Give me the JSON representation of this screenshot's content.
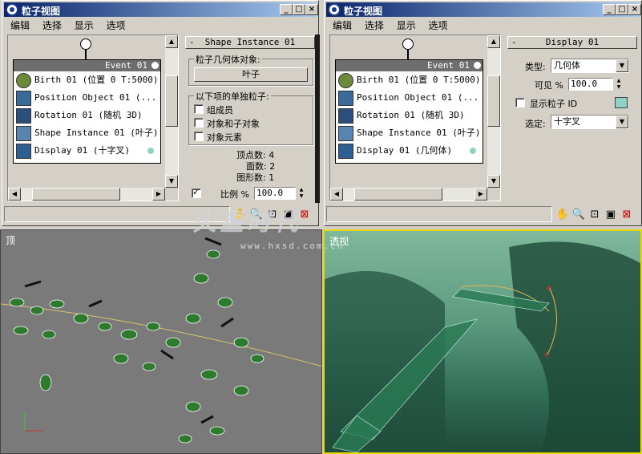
{
  "left_window": {
    "title": "粒子视图",
    "title_buttons": [
      "_",
      "□",
      "×"
    ],
    "menu": [
      "编辑",
      "选择",
      "显示",
      "选项"
    ],
    "event_header": "Event 01",
    "operators": [
      {
        "label": "Birth 01 (位置 0 T:5000)",
        "icon": "birth-icon"
      },
      {
        "label": "Position Object 01 (...",
        "icon": "position-icon"
      },
      {
        "label": "Rotation 01 (随机 3D)",
        "icon": "rotation-icon"
      },
      {
        "label": "Shape Instance 01 (叶子)",
        "icon": "shape-instance-icon"
      },
      {
        "label": "Display 01 (十字叉)",
        "icon": "display-icon"
      }
    ],
    "rollout": {
      "title": "Shape Instance 01",
      "geom_group": "粒子几何体对象:",
      "geom_button": "叶子",
      "separate_group": "以下项的单独粒子:",
      "checkboxes": [
        "组成员",
        "对象和子对象",
        "对象元素"
      ],
      "vertex_count": "顶点数: 4",
      "face_count": "面数: 2",
      "element_count": "图形数: 1",
      "scale_label": "比例 %",
      "scale_value": "100.0"
    }
  },
  "right_window": {
    "title": "粒子视图",
    "title_buttons": [
      "_",
      "□",
      "×"
    ],
    "menu": [
      "编辑",
      "选择",
      "显示",
      "选项"
    ],
    "event_header": "Event 01",
    "operators": [
      {
        "label": "Birth 01 (位置 0 T:5000)",
        "icon": "birth-icon"
      },
      {
        "label": "Position Object 01 (...",
        "icon": "position-icon"
      },
      {
        "label": "Rotation 01 (随机 3D)",
        "icon": "rotation-icon"
      },
      {
        "label": "Shape Instance 01 (叶子)",
        "icon": "shape-instance-icon"
      },
      {
        "label": "Display 01 (几何体)",
        "icon": "display-icon"
      }
    ],
    "rollout": {
      "title": "Display 01",
      "type_label": "类型:",
      "type_value": "几何体",
      "visible_label": "可见 %",
      "visible_value": "100.0",
      "show_id_label": "显示粒子 ID",
      "selected_label": "选定:",
      "selected_value": "十字叉"
    }
  },
  "viewports": {
    "top_label": "顶",
    "persp_label": "透视"
  },
  "watermark": {
    "text": "火星时代",
    "url": "www.hxsd.com.cn"
  },
  "colors": {
    "title_gradient_start": "#0a246a",
    "display_swatch": "#8fd3c6",
    "active_viewport_border": "#e8d800"
  }
}
